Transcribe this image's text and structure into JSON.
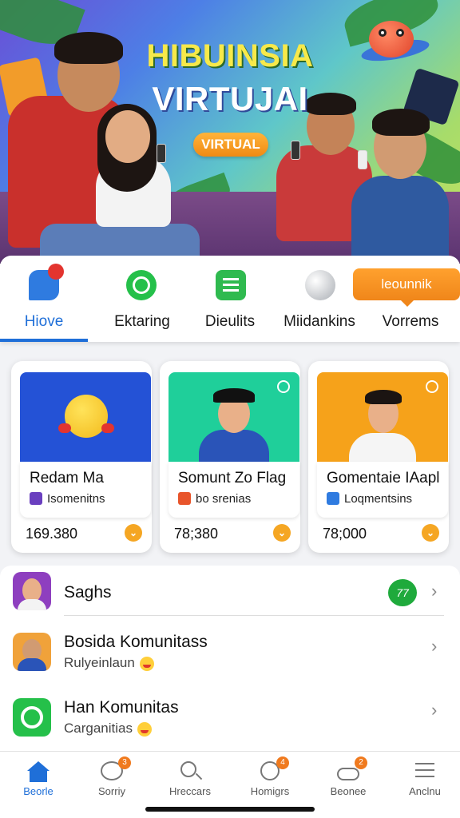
{
  "hero": {
    "title_line1": "HIBUINSIA",
    "title_line2": "VIRTUJAI",
    "badge": "VIRTUAL"
  },
  "tabs": [
    {
      "label": "Hiove",
      "icon": "chat-bubble-icon",
      "color": "#2f7be0",
      "active": true
    },
    {
      "label": "Ektaring",
      "icon": "whatsapp-icon",
      "color": "#25c04a",
      "active": false
    },
    {
      "label": "Dieulits",
      "icon": "list-icon",
      "color": "#2fba4f",
      "active": false
    },
    {
      "label": "Miidankins",
      "icon": "magnifier-icon",
      "color": "#b9bcc2",
      "active": false
    },
    {
      "label": "Vorrems",
      "icon": "",
      "color": "#f0861a",
      "active": false
    }
  ],
  "tooltip": "leounnik",
  "cards": [
    {
      "title": "Redam Ma",
      "subtitle": "Isomenitns",
      "value": "169.380",
      "bg": "#2452d6",
      "subicon_color": "#6a3fbf"
    },
    {
      "title": "Somunt Zo Flag",
      "subtitle": "bo srenias",
      "value": "78;380",
      "bg": "#1fcf9a",
      "subicon_color": "#e8552b"
    },
    {
      "title": "Gomentaie IAapl",
      "subtitle": "Loqmentsins",
      "value": "78;000",
      "bg": "#f6a21a",
      "subicon_color": "#2f7be0"
    }
  ],
  "list": [
    {
      "name": "Saghs",
      "desc": "",
      "badge": "77"
    },
    {
      "name": "Bosida Komunitass",
      "desc": "Rulyeinlaun"
    },
    {
      "name": "Han Komunitas",
      "desc": "Carganitias"
    }
  ],
  "nav": [
    {
      "label": "Beorle",
      "icon": "home-icon",
      "active": true,
      "badge": ""
    },
    {
      "label": "Sorriy",
      "icon": "chat-icon",
      "active": false,
      "badge": "3"
    },
    {
      "label": "Hreccars",
      "icon": "search-icon",
      "active": false,
      "badge": ""
    },
    {
      "label": "Homigrs",
      "icon": "clock-icon",
      "active": false,
      "badge": "4"
    },
    {
      "label": "Beonee",
      "icon": "cloud-icon",
      "active": false,
      "badge": "2"
    },
    {
      "label": "Anclnu",
      "icon": "menu-icon",
      "active": false,
      "badge": ""
    }
  ]
}
